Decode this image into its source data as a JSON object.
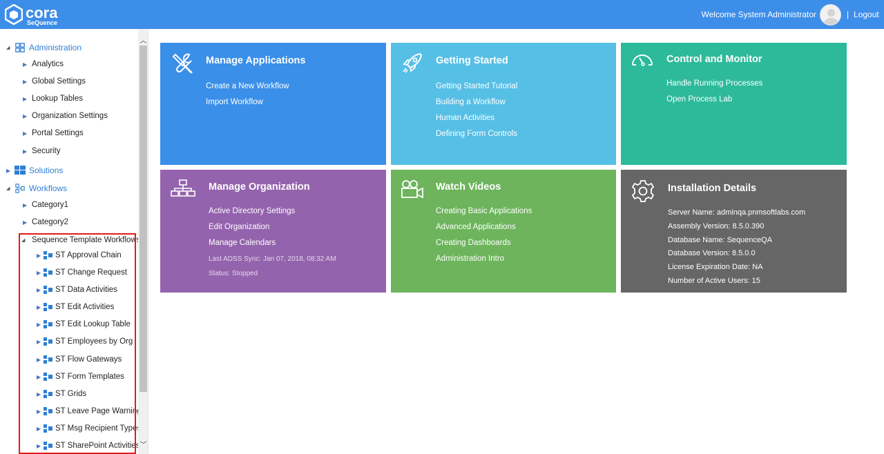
{
  "header": {
    "logo_text": "cora",
    "logo_sub": "SeQuence",
    "welcome": "Welcome System Administrator",
    "separator": "|",
    "logout": "Logout",
    "color": "#3d8ee8"
  },
  "sidebar": {
    "administration": "Administration",
    "admin_items": [
      "Analytics",
      "Global Settings",
      "Lookup Tables",
      "Organization Settings",
      "Portal Settings",
      "Security"
    ],
    "solutions": "Solutions",
    "workflows": "Workflows",
    "categories": [
      "Category1",
      "Category2"
    ],
    "template_group": "Sequence Template Workflows",
    "template_items": [
      "ST Approval Chain",
      "ST Change Request",
      "ST Data Activities",
      "ST Edit Activities",
      "ST Edit Lookup Table",
      "ST Employees by Org",
      "ST Flow Gateways",
      "ST Form Templates",
      "ST Grids",
      "ST Leave Page Warning",
      "ST Msg Recipient Types",
      "ST SharePoint Activities"
    ]
  },
  "tiles": {
    "manage_apps": {
      "title": "Manage Applications",
      "links": [
        "Create a New Workflow",
        "Import Workflow"
      ],
      "color": "#3a8fe8"
    },
    "getting_started": {
      "title": "Getting Started",
      "links": [
        "Getting Started Tutorial",
        "Building a Workflow",
        "Human Activities",
        "Defining Form Controls"
      ],
      "color": "#56bfe6"
    },
    "control_monitor": {
      "title": "Control and Monitor",
      "links": [
        "Handle Running Processes",
        "Open Process Lab"
      ],
      "color": "#2dba9a"
    },
    "manage_org": {
      "title": "Manage Organization",
      "links": [
        "Active Directory Settings",
        "Edit Organization",
        "Manage Calendars"
      ],
      "last_sync": "Last ADSS Sync: Jan 07, 2018, 08:32 AM",
      "status": "Status: Stopped",
      "color": "#9463ad"
    },
    "watch_videos": {
      "title": "Watch Videos",
      "links": [
        "Creating Basic Applications",
        "Advanced Applications",
        "Creating Dashboards",
        "Administration Intro"
      ],
      "color": "#6db45c"
    },
    "installation": {
      "title": "Installation Details",
      "info": [
        "Server Name: adminqa.pnmsoftlabs.com",
        "Assembly Version: 8.5.0.390",
        "Database Name: SequenceQA",
        "Database Version: 8.5.0.0",
        "License Expiration Date: NA",
        "Number of Active Users: 15"
      ],
      "color": "#666666"
    }
  }
}
